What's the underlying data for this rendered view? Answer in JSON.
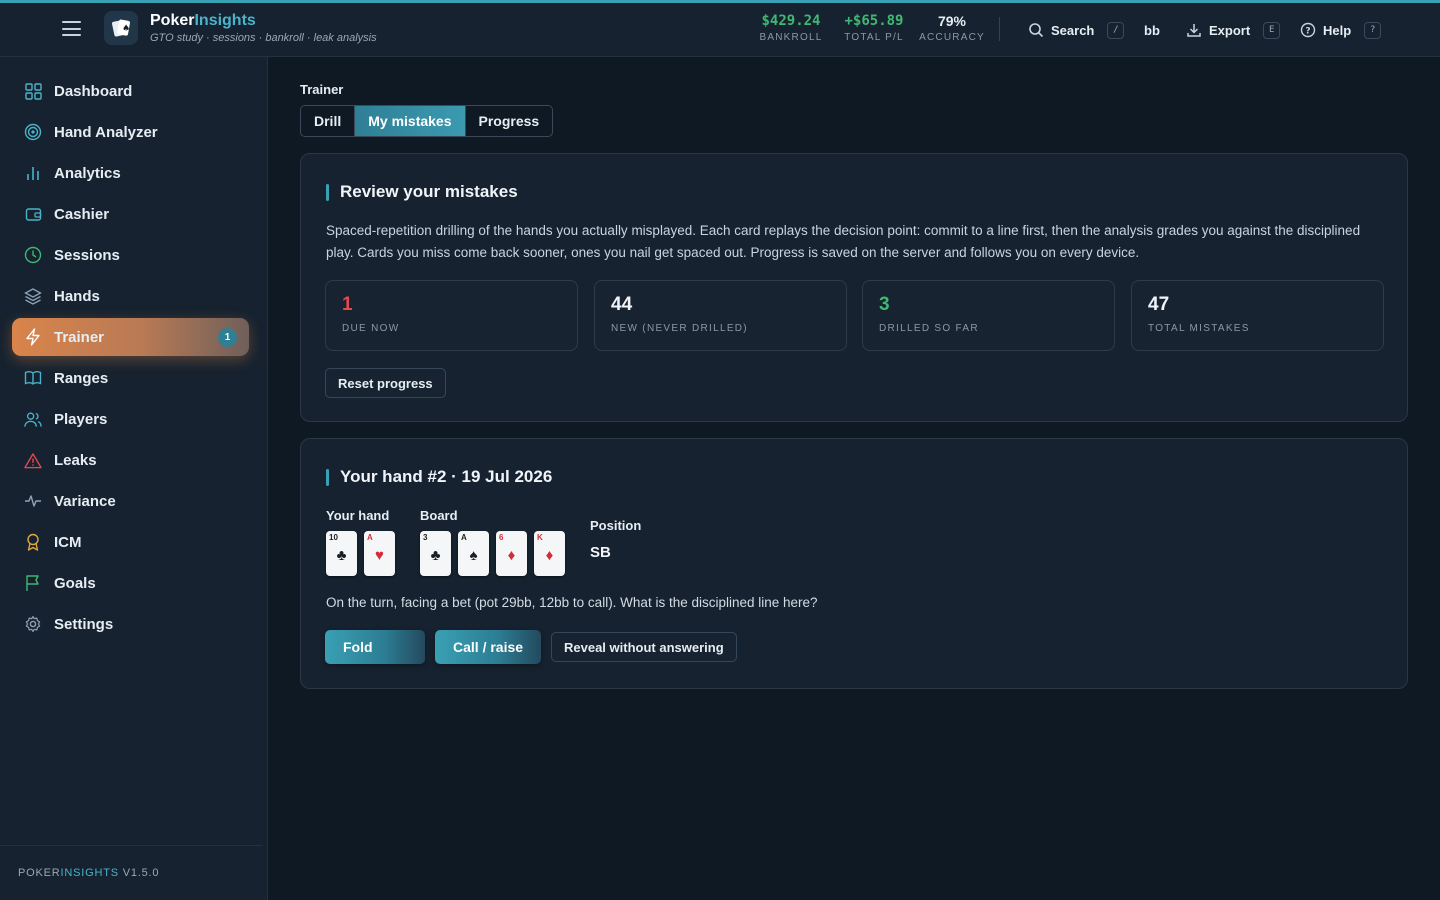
{
  "app": {
    "brand_main": "Poker",
    "brand_accent": "Insights",
    "tagline": "GTO study · sessions · bankroll · leak analysis"
  },
  "stats": [
    {
      "value": "$429.24",
      "label": "BANKROLL",
      "color": "#3fb872"
    },
    {
      "value": "+$65.89",
      "label": "TOTAL P/L",
      "color": "#3fb872"
    },
    {
      "value": "79%",
      "label": "ACCURACY",
      "color": "#e6edf3"
    }
  ],
  "toolbar": {
    "search_label": "Search",
    "search_key": "/",
    "unit_label": "bb",
    "export_label": "Export",
    "export_key": "E",
    "help_label": "Help",
    "help_key": "?"
  },
  "sidebar": {
    "items": [
      {
        "label": "Dashboard",
        "icon": "grid-icon"
      },
      {
        "label": "Hand Analyzer",
        "icon": "target-icon"
      },
      {
        "label": "Analytics",
        "icon": "bar-chart-icon"
      },
      {
        "label": "Cashier",
        "icon": "wallet-icon"
      },
      {
        "label": "Sessions",
        "icon": "clock-icon"
      },
      {
        "label": "Hands",
        "icon": "layers-icon"
      },
      {
        "label": "Trainer",
        "icon": "bolt-icon",
        "badge": "1"
      },
      {
        "label": "Ranges",
        "icon": "book-icon"
      },
      {
        "label": "Players",
        "icon": "users-icon"
      },
      {
        "label": "Leaks",
        "icon": "warning-icon"
      },
      {
        "label": "Variance",
        "icon": "pulse-icon"
      },
      {
        "label": "ICM",
        "icon": "award-icon"
      },
      {
        "label": "Goals",
        "icon": "flag-icon"
      },
      {
        "label": "Settings",
        "icon": "gear-icon"
      }
    ],
    "footer_main": "POKER",
    "footer_accent": "INSIGHTS",
    "footer_version": " V1.5.0"
  },
  "trainer": {
    "section_label": "Trainer",
    "tabs": [
      "Drill",
      "My mistakes",
      "Progress"
    ],
    "active_tab": "My mistakes"
  },
  "review": {
    "title": "Review your mistakes",
    "description": "Spaced-repetition drilling of the hands you actually misplayed. Each card replays the decision point: commit to a line first, then the analysis grades you against the disciplined play. Cards you miss come back sooner, ones you nail get spaced out. Progress is saved on the server and follows you on every device.",
    "metrics": [
      {
        "value": "1",
        "label": "DUE NOW",
        "color": "#e5484d"
      },
      {
        "value": "44",
        "label": "NEW (NEVER DRILLED)",
        "color": "#f1f5f9"
      },
      {
        "value": "3",
        "label": "DRILLED SO FAR",
        "color": "#3fb872"
      },
      {
        "value": "47",
        "label": "TOTAL MISTAKES",
        "color": "#f1f5f9"
      }
    ],
    "reset_label": "Reset progress"
  },
  "hand": {
    "title": "Your hand #2 · 19 Jul 2026",
    "your_hand_label": "Your hand",
    "board_label": "Board",
    "position_label": "Position",
    "position_value": "SB",
    "hole_cards": [
      {
        "rank": "10",
        "suit": "♣",
        "color": "black"
      },
      {
        "rank": "A",
        "suit": "♥",
        "color": "red"
      }
    ],
    "board_cards": [
      {
        "rank": "3",
        "suit": "♣",
        "color": "black"
      },
      {
        "rank": "A",
        "suit": "♠",
        "color": "black"
      },
      {
        "rank": "6",
        "suit": "♦",
        "color": "red"
      },
      {
        "rank": "K",
        "suit": "♦",
        "color": "red"
      }
    ],
    "question": "On the turn, facing a bet (pot 29bb, 12bb to call). What is the disciplined line here?",
    "fold_label": "Fold",
    "call_label": "Call / raise",
    "reveal_label": "Reveal without answering"
  }
}
